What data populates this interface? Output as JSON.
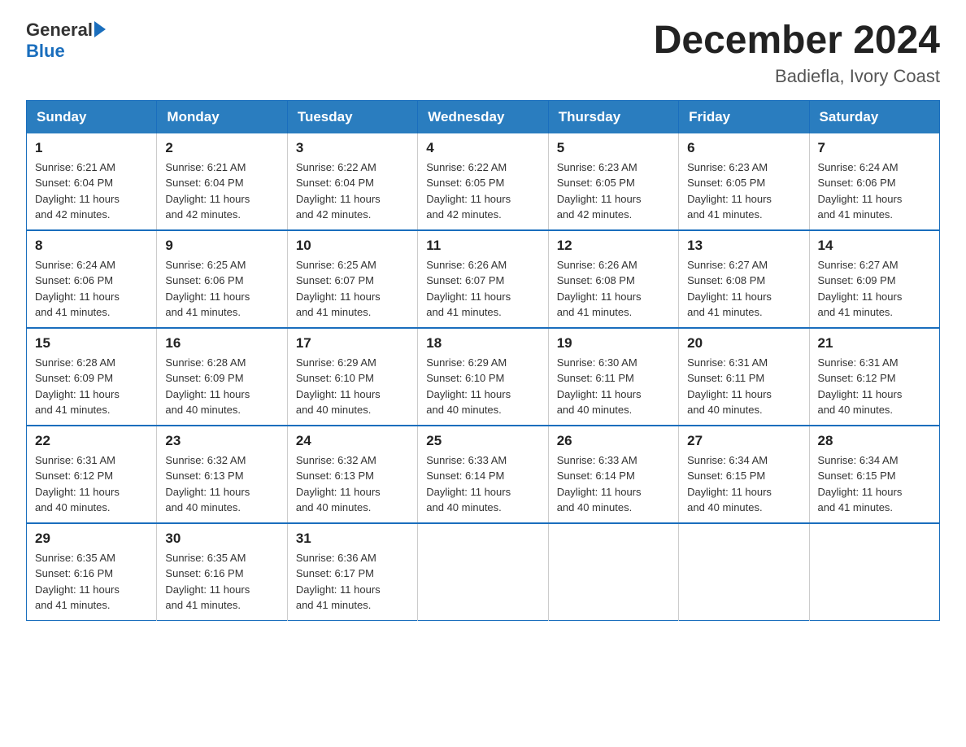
{
  "header": {
    "logo_general": "General",
    "logo_blue": "Blue",
    "month_title": "December 2024",
    "location": "Badiefla, Ivory Coast"
  },
  "weekdays": [
    "Sunday",
    "Monday",
    "Tuesday",
    "Wednesday",
    "Thursday",
    "Friday",
    "Saturday"
  ],
  "weeks": [
    [
      {
        "day": "1",
        "sunrise": "6:21 AM",
        "sunset": "6:04 PM",
        "daylight": "11 hours and 42 minutes."
      },
      {
        "day": "2",
        "sunrise": "6:21 AM",
        "sunset": "6:04 PM",
        "daylight": "11 hours and 42 minutes."
      },
      {
        "day": "3",
        "sunrise": "6:22 AM",
        "sunset": "6:04 PM",
        "daylight": "11 hours and 42 minutes."
      },
      {
        "day": "4",
        "sunrise": "6:22 AM",
        "sunset": "6:05 PM",
        "daylight": "11 hours and 42 minutes."
      },
      {
        "day": "5",
        "sunrise": "6:23 AM",
        "sunset": "6:05 PM",
        "daylight": "11 hours and 42 minutes."
      },
      {
        "day": "6",
        "sunrise": "6:23 AM",
        "sunset": "6:05 PM",
        "daylight": "11 hours and 41 minutes."
      },
      {
        "day": "7",
        "sunrise": "6:24 AM",
        "sunset": "6:06 PM",
        "daylight": "11 hours and 41 minutes."
      }
    ],
    [
      {
        "day": "8",
        "sunrise": "6:24 AM",
        "sunset": "6:06 PM",
        "daylight": "11 hours and 41 minutes."
      },
      {
        "day": "9",
        "sunrise": "6:25 AM",
        "sunset": "6:06 PM",
        "daylight": "11 hours and 41 minutes."
      },
      {
        "day": "10",
        "sunrise": "6:25 AM",
        "sunset": "6:07 PM",
        "daylight": "11 hours and 41 minutes."
      },
      {
        "day": "11",
        "sunrise": "6:26 AM",
        "sunset": "6:07 PM",
        "daylight": "11 hours and 41 minutes."
      },
      {
        "day": "12",
        "sunrise": "6:26 AM",
        "sunset": "6:08 PM",
        "daylight": "11 hours and 41 minutes."
      },
      {
        "day": "13",
        "sunrise": "6:27 AM",
        "sunset": "6:08 PM",
        "daylight": "11 hours and 41 minutes."
      },
      {
        "day": "14",
        "sunrise": "6:27 AM",
        "sunset": "6:09 PM",
        "daylight": "11 hours and 41 minutes."
      }
    ],
    [
      {
        "day": "15",
        "sunrise": "6:28 AM",
        "sunset": "6:09 PM",
        "daylight": "11 hours and 41 minutes."
      },
      {
        "day": "16",
        "sunrise": "6:28 AM",
        "sunset": "6:09 PM",
        "daylight": "11 hours and 40 minutes."
      },
      {
        "day": "17",
        "sunrise": "6:29 AM",
        "sunset": "6:10 PM",
        "daylight": "11 hours and 40 minutes."
      },
      {
        "day": "18",
        "sunrise": "6:29 AM",
        "sunset": "6:10 PM",
        "daylight": "11 hours and 40 minutes."
      },
      {
        "day": "19",
        "sunrise": "6:30 AM",
        "sunset": "6:11 PM",
        "daylight": "11 hours and 40 minutes."
      },
      {
        "day": "20",
        "sunrise": "6:31 AM",
        "sunset": "6:11 PM",
        "daylight": "11 hours and 40 minutes."
      },
      {
        "day": "21",
        "sunrise": "6:31 AM",
        "sunset": "6:12 PM",
        "daylight": "11 hours and 40 minutes."
      }
    ],
    [
      {
        "day": "22",
        "sunrise": "6:31 AM",
        "sunset": "6:12 PM",
        "daylight": "11 hours and 40 minutes."
      },
      {
        "day": "23",
        "sunrise": "6:32 AM",
        "sunset": "6:13 PM",
        "daylight": "11 hours and 40 minutes."
      },
      {
        "day": "24",
        "sunrise": "6:32 AM",
        "sunset": "6:13 PM",
        "daylight": "11 hours and 40 minutes."
      },
      {
        "day": "25",
        "sunrise": "6:33 AM",
        "sunset": "6:14 PM",
        "daylight": "11 hours and 40 minutes."
      },
      {
        "day": "26",
        "sunrise": "6:33 AM",
        "sunset": "6:14 PM",
        "daylight": "11 hours and 40 minutes."
      },
      {
        "day": "27",
        "sunrise": "6:34 AM",
        "sunset": "6:15 PM",
        "daylight": "11 hours and 40 minutes."
      },
      {
        "day": "28",
        "sunrise": "6:34 AM",
        "sunset": "6:15 PM",
        "daylight": "11 hours and 41 minutes."
      }
    ],
    [
      {
        "day": "29",
        "sunrise": "6:35 AM",
        "sunset": "6:16 PM",
        "daylight": "11 hours and 41 minutes."
      },
      {
        "day": "30",
        "sunrise": "6:35 AM",
        "sunset": "6:16 PM",
        "daylight": "11 hours and 41 minutes."
      },
      {
        "day": "31",
        "sunrise": "6:36 AM",
        "sunset": "6:17 PM",
        "daylight": "11 hours and 41 minutes."
      },
      null,
      null,
      null,
      null
    ]
  ],
  "labels": {
    "sunrise": "Sunrise:",
    "sunset": "Sunset:",
    "daylight": "Daylight:"
  }
}
